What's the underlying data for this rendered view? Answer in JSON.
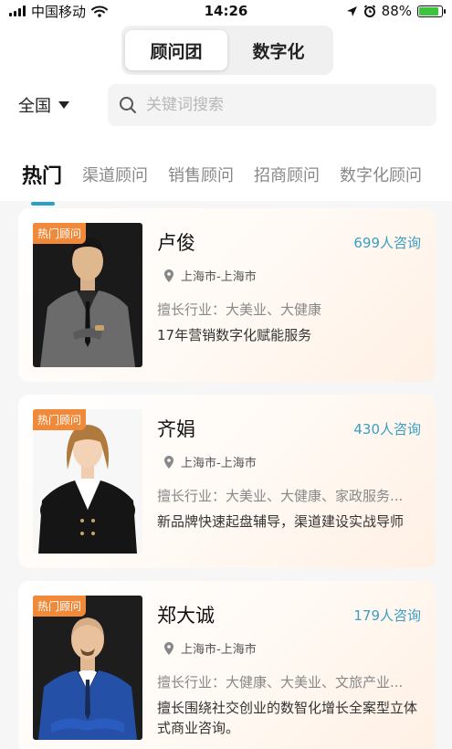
{
  "status_bar": {
    "carrier": "中国移动",
    "time": "14:26",
    "battery": "88%",
    "battery_level": 0.88
  },
  "segmented": {
    "options": [
      {
        "label": "顾问团",
        "active": true
      },
      {
        "label": "数字化",
        "active": false
      }
    ]
  },
  "filter": {
    "region": "全国",
    "search_placeholder": "关键词搜索"
  },
  "tabs": [
    {
      "label": "热门",
      "active": true
    },
    {
      "label": "渠道顾问",
      "active": false
    },
    {
      "label": "销售顾问",
      "active": false
    },
    {
      "label": "招商顾问",
      "active": false
    },
    {
      "label": "数字化顾问",
      "active": false
    }
  ],
  "consultants": [
    {
      "badge": "热门顾问",
      "name": "卢俊",
      "count": "699人咨询",
      "location": "上海市-上海市",
      "industry": "擅长行业：大美业、大健康",
      "description": "17年营销数字化赋能服务"
    },
    {
      "badge": "热门顾问",
      "name": "齐娟",
      "count": "430人咨询",
      "location": "上海市-上海市",
      "industry": "擅长行业：大美业、大健康、家政服务...",
      "description": "新品牌快速起盘辅导，渠道建设实战导师"
    },
    {
      "badge": "热门顾问",
      "name": "郑大诚",
      "count": "179人咨询",
      "location": "上海市-上海市",
      "industry": "擅长行业：大健康、大美业、文旅产业...",
      "description": "擅长围绕社交创业的数智化增长全案型立体式商业咨询。"
    }
  ]
}
